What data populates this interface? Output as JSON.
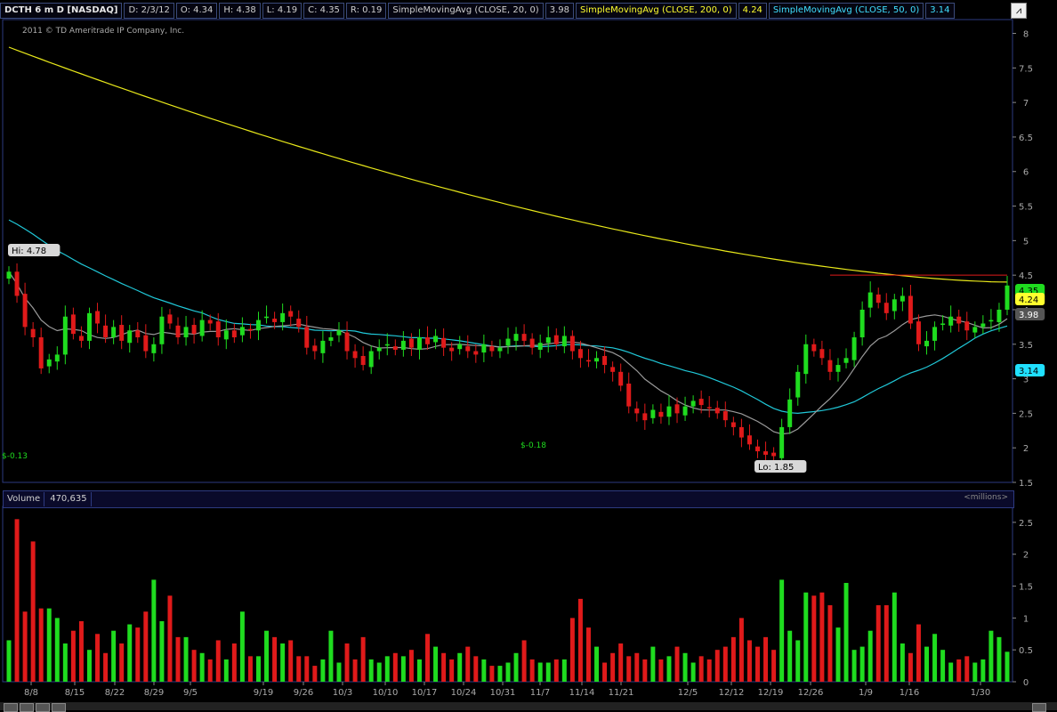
{
  "header": {
    "symbol": "DCTH 6 m D [NASDAQ]",
    "date": "D: 2/3/12",
    "open": "O: 4.34",
    "high": "H: 4.38",
    "low": "L: 4.19",
    "close": "C: 4.35",
    "range": "R: 0.19",
    "sma20_label": "SimpleMovingAvg (CLOSE, 20, 0)",
    "sma20_value": "3.98",
    "sma200_label": "SimpleMovingAvg (CLOSE, 200, 0)",
    "sma200_value": "4.24",
    "sma50_label": "SimpleMovingAvg (CLOSE, 50, 0)",
    "sma50_value": "3.14"
  },
  "copyright": "2011 © TD Ameritrade IP Company, Inc.",
  "volume_header": {
    "label": "Volume",
    "value": "470,635",
    "unit": "<millions>"
  },
  "colors": {
    "up": "#1fdc1f",
    "down": "#e01a1a",
    "sma200": "#e8e81a",
    "sma50": "#20c8d8",
    "sma20": "#9a9a9a",
    "grid": "#333"
  },
  "chart_data": [
    {
      "type": "candlestick",
      "title": "",
      "ylim": [
        1.5,
        8.2
      ],
      "y_ticks": [
        "1.5",
        "2",
        "2.5",
        "3",
        "3.5",
        "4",
        "4.5",
        "5",
        "5.5",
        "6",
        "6.5",
        "7",
        "7.5",
        "8"
      ],
      "x_tick_labels": [
        "8/8",
        "8/15",
        "8/22",
        "8/29",
        "9/5",
        "9/19",
        "9/26",
        "10/3",
        "10/10",
        "10/17",
        "10/24",
        "10/31",
        "11/7",
        "11/14",
        "11/21",
        "12/5",
        "12/12",
        "12/19",
        "12/26",
        "1/9",
        "1/16",
        "1/30"
      ],
      "annotations": {
        "high": "Hi: 4.78",
        "low": "Lo: 1.85",
        "div1": "$-0.13",
        "div2": "$-0.18"
      },
      "last_price_labels": {
        "close": "4.35",
        "sma200": "4.24",
        "sma20": "3.98",
        "sma50": "3.14"
      },
      "closes": [
        4.55,
        4.2,
        3.75,
        3.6,
        3.15,
        3.28,
        3.35,
        3.9,
        3.65,
        3.55,
        3.95,
        3.8,
        3.6,
        3.75,
        3.55,
        3.7,
        3.6,
        3.4,
        3.5,
        3.9,
        3.8,
        3.6,
        3.75,
        3.65,
        3.85,
        3.8,
        3.6,
        3.7,
        3.6,
        3.75,
        3.7,
        3.85,
        3.9,
        3.82,
        3.95,
        3.9,
        3.75,
        3.45,
        3.4,
        3.55,
        3.6,
        3.7,
        3.4,
        3.3,
        3.2,
        3.4,
        3.45,
        3.5,
        3.42,
        3.55,
        3.45,
        3.6,
        3.5,
        3.62,
        3.45,
        3.4,
        3.5,
        3.4,
        3.35,
        3.5,
        3.4,
        3.45,
        3.58,
        3.65,
        3.55,
        3.45,
        3.52,
        3.6,
        3.5,
        3.62,
        3.4,
        3.3,
        3.25,
        3.3,
        3.2,
        3.1,
        2.9,
        2.6,
        2.5,
        2.4,
        2.55,
        2.45,
        2.6,
        2.5,
        2.6,
        2.68,
        2.62,
        2.58,
        2.5,
        2.4,
        2.3,
        2.15,
        2.05,
        1.95,
        1.9,
        1.88,
        2.3,
        2.7,
        3.1,
        3.5,
        3.4,
        3.3,
        3.1,
        3.2,
        3.3,
        3.6,
        4.0,
        4.25,
        4.1,
        3.95,
        4.15,
        4.2,
        3.8,
        3.5,
        3.55,
        3.75,
        3.8,
        3.9,
        3.8,
        3.7,
        3.75,
        3.8,
        3.85,
        4.0,
        4.35
      ],
      "volumes_millions": [
        0.65,
        2.55,
        1.1,
        2.2,
        1.15,
        1.15,
        1.0,
        0.6,
        0.8,
        0.95,
        0.5,
        0.75,
        0.45,
        0.8,
        0.6,
        0.9,
        0.85,
        1.1,
        1.6,
        0.95,
        1.35,
        0.7,
        0.7,
        0.5,
        0.45,
        0.35,
        0.65,
        0.35,
        0.6,
        1.1,
        0.4,
        0.4,
        0.8,
        0.7,
        0.6,
        0.65,
        0.4,
        0.4,
        0.25,
        0.35,
        0.8,
        0.3,
        0.6,
        0.35,
        0.7,
        0.35,
        0.3,
        0.4,
        0.45,
        0.4,
        0.5,
        0.35,
        0.75,
        0.55,
        0.45,
        0.35,
        0.45,
        0.55,
        0.4,
        0.35,
        0.25,
        0.25,
        0.3,
        0.45,
        0.65,
        0.35,
        0.3,
        0.3,
        0.35,
        0.35,
        1.0,
        1.3,
        0.85,
        0.55,
        0.3,
        0.45,
        0.6,
        0.4,
        0.45,
        0.35,
        0.55,
        0.35,
        0.4,
        0.55,
        0.45,
        0.3,
        0.4,
        0.35,
        0.5,
        0.55,
        0.7,
        1.0,
        0.65,
        0.55,
        0.7,
        0.5,
        1.6,
        0.8,
        0.65,
        1.4,
        1.35,
        1.4,
        1.2,
        0.85,
        1.55,
        0.5,
        0.55,
        0.8,
        1.2,
        1.2,
        1.4,
        0.6,
        0.45,
        0.9,
        0.55,
        0.75,
        0.5,
        0.3,
        0.35,
        0.4,
        0.3,
        0.35,
        0.8,
        0.7,
        0.47
      ]
    }
  ]
}
